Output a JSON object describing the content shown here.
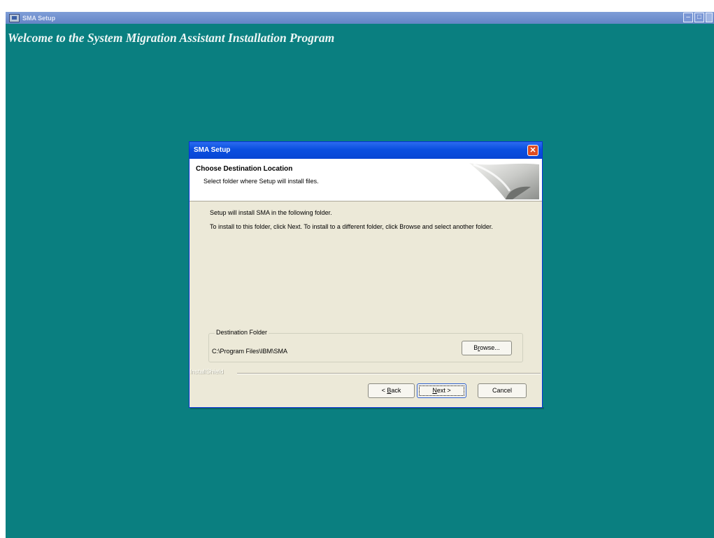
{
  "app": {
    "title": "SMA Setup",
    "welcome": "Welcome to the System Migration Assistant Installation Program",
    "background_color": "#0a7f80"
  },
  "dialog": {
    "title": "SMA Setup",
    "close_icon": "close-icon",
    "header": {
      "title": "Choose Destination Location",
      "subtitle": "Select folder where Setup will install files."
    },
    "intro": "Setup will install SMA in the following folder.",
    "instructions": "To install to this folder, click Next. To install to a different folder, click Browse and select another folder.",
    "destination": {
      "legend": "Destination Folder",
      "path": "C:\\Program Files\\IBM\\SMA",
      "browse_label_pre": "B",
      "browse_label_ul": "r",
      "browse_label_post": "owse..."
    },
    "footer_brand": "InstallShield",
    "buttons": {
      "back_pre": "< ",
      "back_ul": "B",
      "back_post": "ack",
      "next_ul": "N",
      "next_post": "ext >",
      "cancel": "Cancel"
    }
  }
}
